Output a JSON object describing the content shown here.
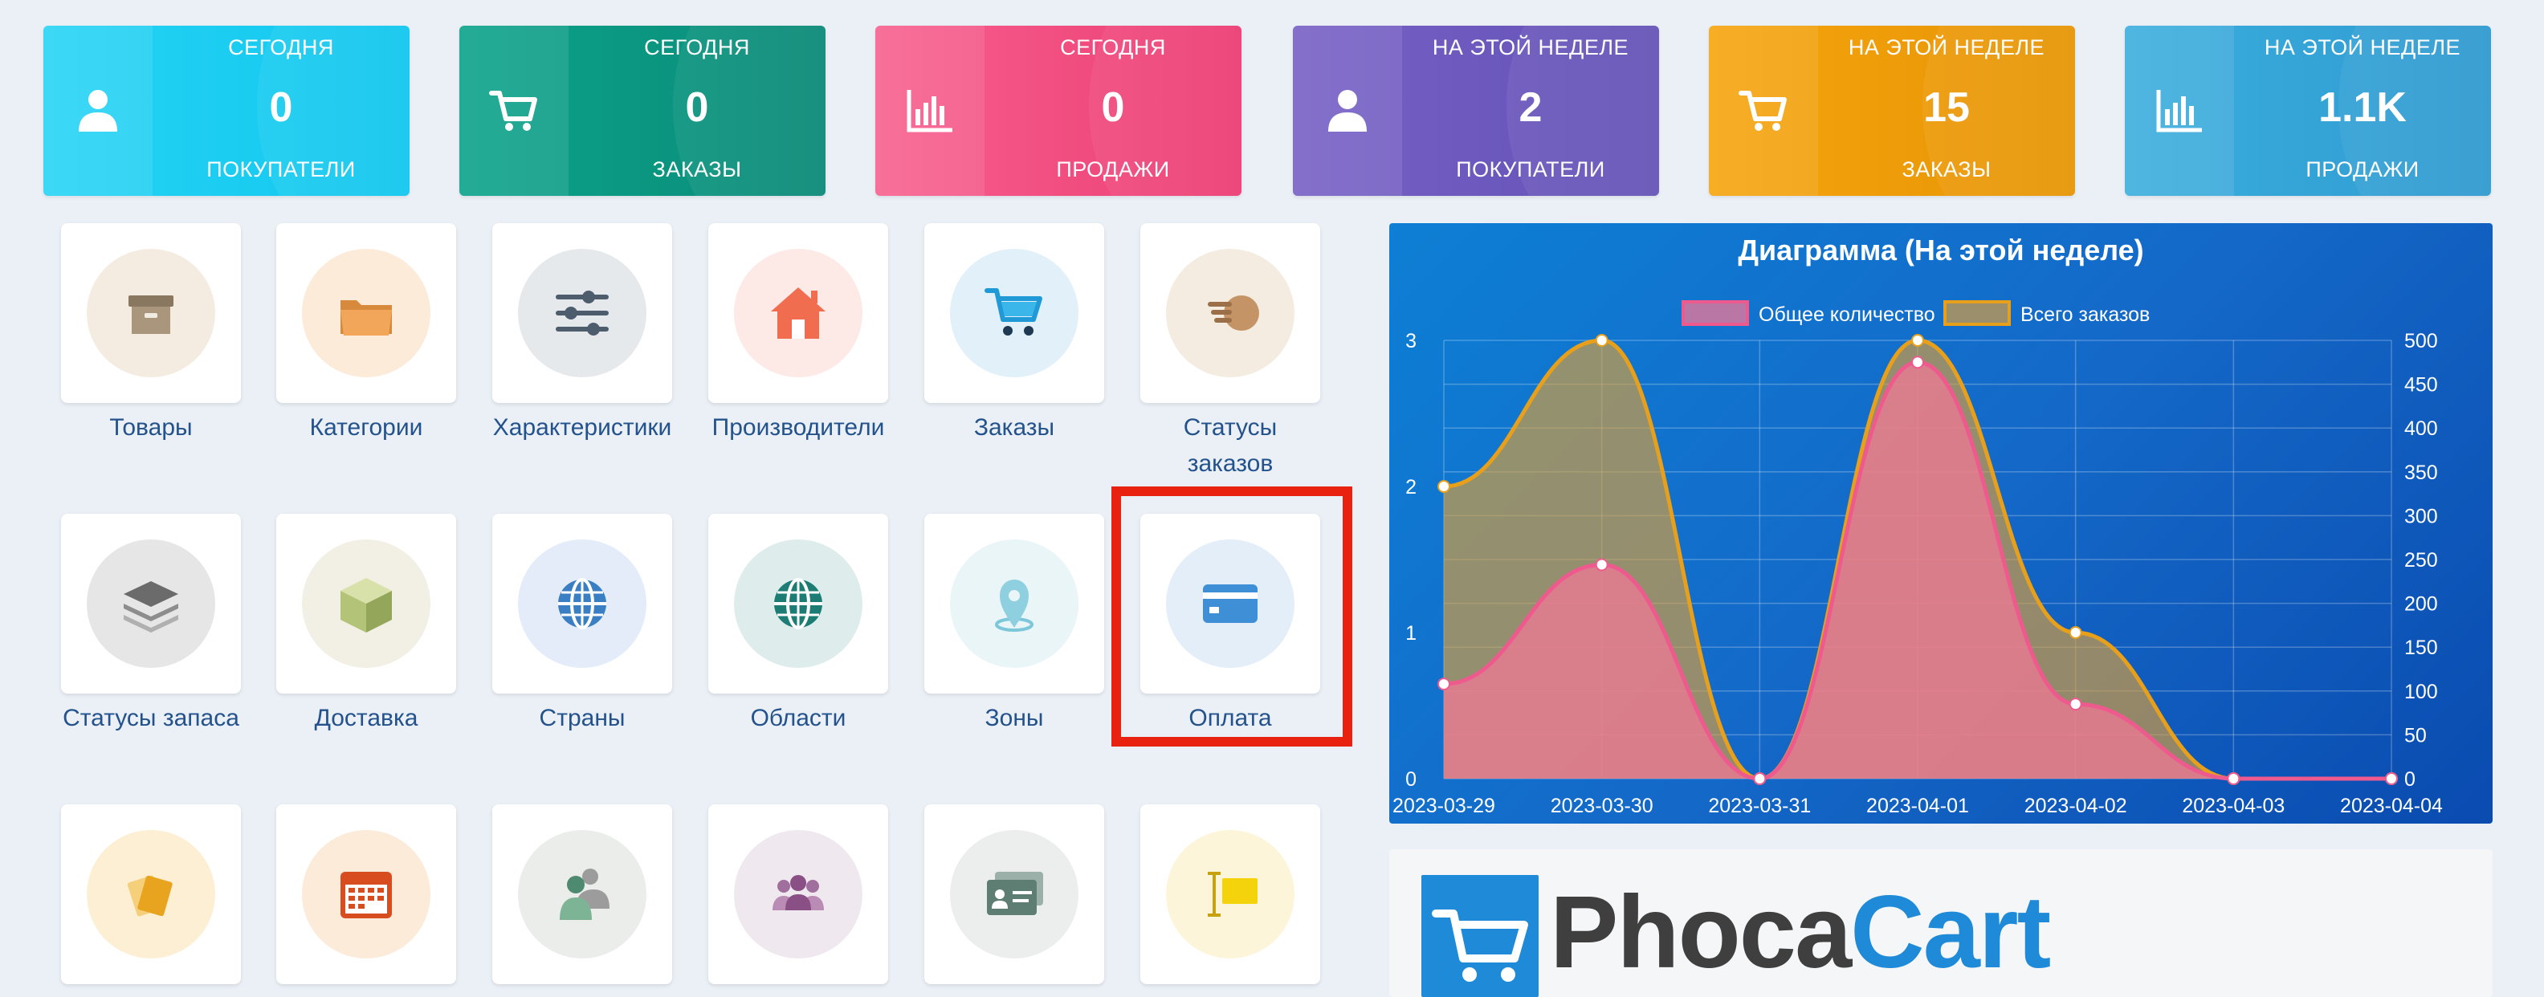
{
  "stats": [
    {
      "period": "СЕГОДНЯ",
      "value": "0",
      "label": "ПОКУПАТЕЛИ",
      "icon": "user-icon",
      "color_from": "#26d4f5",
      "color_to": "#12c6ee"
    },
    {
      "period": "СЕГОДНЯ",
      "value": "0",
      "label": "ЗАКАЗЫ",
      "icon": "cart-icon",
      "color_from": "#0ba38a",
      "color_to": "#0b8a78"
    },
    {
      "period": "СЕГОДНЯ",
      "value": "0",
      "label": "ПРОДАЖИ",
      "icon": "bar-chart-icon",
      "color_from": "#f7608e",
      "color_to": "#ec3d74"
    },
    {
      "period": "НА ЭТОЙ НЕДЕЛЕ",
      "value": "2",
      "label": "ПОКУПАТЕЛИ",
      "icon": "user-icon",
      "color_from": "#7660c6",
      "color_to": "#6553b6"
    },
    {
      "period": "НА ЭТОЙ НЕДЕЛЕ",
      "value": "15",
      "label": "ЗАКАЗЫ",
      "icon": "cart-icon",
      "color_from": "#f6a40c",
      "color_to": "#e69506"
    },
    {
      "period": "НА ЭТОЙ НЕДЕЛЕ",
      "value": "1.1K",
      "label": "ПРОДАЖИ",
      "icon": "bar-chart-icon",
      "color_from": "#3aaede",
      "color_to": "#2f9ad0"
    }
  ],
  "tiles": [
    {
      "name": "Товары",
      "icon": "box-icon",
      "bg": "#f4ece1"
    },
    {
      "name": "Категории",
      "icon": "folder-icon",
      "bg": "#fcebd9"
    },
    {
      "name": "Характеристики",
      "icon": "sliders-icon",
      "bg": "#e6e9ec"
    },
    {
      "name": "Производители",
      "icon": "house-icon",
      "bg": "#fde9e6"
    },
    {
      "name": "Заказы",
      "icon": "cart-icon",
      "bg": "#e2f1f9"
    },
    {
      "name": "Статусы заказов",
      "icon": "hand-icon",
      "bg": "#f4ece1"
    },
    {
      "name": "Статусы запаса",
      "icon": "layers-icon",
      "bg": "#e6e6e6"
    },
    {
      "name": "Доставка",
      "icon": "package-icon",
      "bg": "#f2efe4"
    },
    {
      "name": "Страны",
      "icon": "globe-icon",
      "bg": "#e3ecf8"
    },
    {
      "name": "Области",
      "icon": "globe-icon",
      "bg": "#deeceb"
    },
    {
      "name": "Зоны",
      "icon": "map-pin-icon",
      "bg": "#eaf5f8"
    },
    {
      "name": "Оплата",
      "icon": "credit-card-icon",
      "bg": "#e3eef9"
    },
    {
      "name": "",
      "icon": "tags-icon",
      "bg": "#fcefd4"
    },
    {
      "name": "",
      "icon": "calendar-icon",
      "bg": "#fcebd9"
    },
    {
      "name": "",
      "icon": "user-id-icon",
      "bg": "#ebedeb"
    },
    {
      "name": "",
      "icon": "users-icon",
      "bg": "#efe9ef"
    },
    {
      "name": "",
      "icon": "contact-card-icon",
      "bg": "#eceeed"
    },
    {
      "name": "",
      "icon": "text-highlight-icon",
      "bg": "#fdf5da"
    }
  ],
  "chart_data": {
    "type": "area",
    "title": "Диаграмма (На этой неделе)",
    "categories": [
      "2023-03-29",
      "2023-03-30",
      "2023-03-31",
      "2023-04-01",
      "2023-04-02",
      "2023-04-03",
      "2023-04-04"
    ],
    "series": [
      {
        "name": "Общее количество",
        "axis": "right",
        "values": [
          108,
          244,
          0,
          475,
          85,
          0,
          0
        ],
        "color": "#ef5a8e"
      },
      {
        "name": "Всего заказов",
        "axis": "left",
        "values": [
          2,
          3,
          0,
          3,
          1,
          0,
          0
        ],
        "color": "#e8a01a"
      }
    ],
    "y_left": {
      "min": 0,
      "max": 3,
      "ticks": [
        0,
        1,
        2,
        3
      ]
    },
    "y_right": {
      "min": 0,
      "max": 500,
      "ticks": [
        0,
        50,
        100,
        150,
        200,
        250,
        300,
        350,
        400,
        450,
        500
      ]
    },
    "grid": true,
    "legend": "top-center"
  },
  "logo": {
    "part1": "Phoca",
    "part2": "Cart"
  }
}
